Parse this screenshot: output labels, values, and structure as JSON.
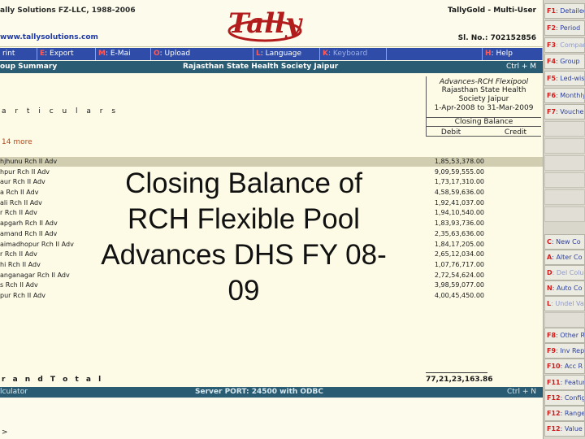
{
  "header": {
    "company_line": "ally Solutions FZ-LLC, 1988-2006",
    "url": "www.tallysolutions.com",
    "logo_text": "Tally",
    "product": "TallyGold - Multi-User",
    "serial": "Sl. No.: 702152856"
  },
  "button_bar": [
    {
      "key": "",
      "label": "rint",
      "dim": false
    },
    {
      "key": "E",
      "label": ": Export",
      "dim": false
    },
    {
      "key": "M",
      "label": ": E-Mai",
      "dim": false
    },
    {
      "key": "O",
      "label": ": Upload",
      "dim": false
    },
    {
      "key": "",
      "label": "",
      "dim": false
    },
    {
      "key": "L",
      "label": ": Language",
      "dim": false
    },
    {
      "key": "K",
      "label": ": Keyboard",
      "dim": true
    },
    {
      "key": "",
      "label": "",
      "dim": false
    },
    {
      "key": "H",
      "label": ": Help",
      "dim": false
    }
  ],
  "title_bar": {
    "left": "oup Summary",
    "center": "Rajasthan State Health Society Jaipur",
    "right": "Ctrl + M"
  },
  "report": {
    "particulars_label": "a r t i c u l a r s",
    "column_heading": {
      "title": "Advances-RCH Flexipool",
      "company_line1": "Rajasthan State Health",
      "company_line2": "Society Jaipur",
      "period": "1-Apr-2008 to 31-Mar-2009",
      "balance_label": "Closing Balance",
      "debit_label": "Debit",
      "credit_label": "Credit"
    },
    "more_label": "14 more",
    "rows": [
      {
        "name": "hjhunu Rch II Adv",
        "amount": "1,85,53,378.00"
      },
      {
        "name": "hpur Rch II Adv",
        "amount": "9,09,59,555.00"
      },
      {
        "name": "aur Rch II Adv",
        "amount": "1,73,17,310.00"
      },
      {
        "name": "a Rch II Adv",
        "amount": "4,58,59,636.00"
      },
      {
        "name": "ali Rch II Adv",
        "amount": "1,92,41,037.00"
      },
      {
        "name": "r Rch II Adv",
        "amount": "1,94,10,540.00"
      },
      {
        "name": "apgarh Rch II Adv",
        "amount": "1,83,93,736.00"
      },
      {
        "name": "amand Rch II Adv",
        "amount": "2,35,63,636.00"
      },
      {
        "name": "aimadhopur Rch II Adv",
        "amount": "1,84,17,205.00"
      },
      {
        "name": "r Rch II Adv",
        "amount": "2,65,12,034.00"
      },
      {
        "name": "hi Rch II Adv",
        "amount": "1,07,76,717.00"
      },
      {
        "name": "anganagar Rch II Adv",
        "amount": "2,72,54,624.00"
      },
      {
        "name": "s Rch II Adv",
        "amount": "3,98,59,077.00"
      },
      {
        "name": "pur Rch II Adv",
        "amount": "4,00,45,450.00"
      }
    ],
    "overlay_text": "Closing Balance of RCH Flexible Pool Advances DHS FY 08-09",
    "grand_total_label": "r a n d   T o t a l",
    "grand_total_amount": "77,21,23,163.86"
  },
  "calculator": {
    "left": "lculator",
    "center": "Server PORT: 24500 with ODBC",
    "right": "Ctrl + N",
    "prompt": ">"
  },
  "right_panel": [
    {
      "key": "F1",
      "label": ": Detailed",
      "dim": false
    },
    {
      "key": "F2",
      "label": ": Period",
      "dim": false
    },
    {
      "key": "F3",
      "label": ": Compan",
      "dim": true
    },
    {
      "key": "F4",
      "label": ": Group",
      "dim": false
    },
    {
      "key": "F5",
      "label": ": Led-wise",
      "dim": false
    },
    {
      "key": "F6",
      "label": ": Monthly",
      "dim": false
    },
    {
      "key": "F7",
      "label": ": Voucher",
      "dim": false
    },
    {
      "key": "C",
      "label": ": New Co",
      "dim": false
    },
    {
      "key": "A",
      "label": ": Alter Co",
      "dim": false
    },
    {
      "key": "D",
      "label": ": Del Colu",
      "dim": true
    },
    {
      "key": "N",
      "label": ": Auto Co",
      "dim": false
    },
    {
      "key": "L",
      "label": ": Undel Va",
      "dim": true
    },
    {
      "key": "F8",
      "label": ": Other R",
      "dim": false
    },
    {
      "key": "F9",
      "label": ": Inv Rep",
      "dim": false
    },
    {
      "key": "F10",
      "label": ": Acc R",
      "dim": false
    },
    {
      "key": "F11",
      "label": ": Featur",
      "dim": false
    },
    {
      "key": "F12",
      "label": ": Config",
      "dim": false
    },
    {
      "key": "F12",
      "label": ": Range",
      "dim": false
    },
    {
      "key": "F12",
      "label": ": Value",
      "dim": false
    }
  ]
}
